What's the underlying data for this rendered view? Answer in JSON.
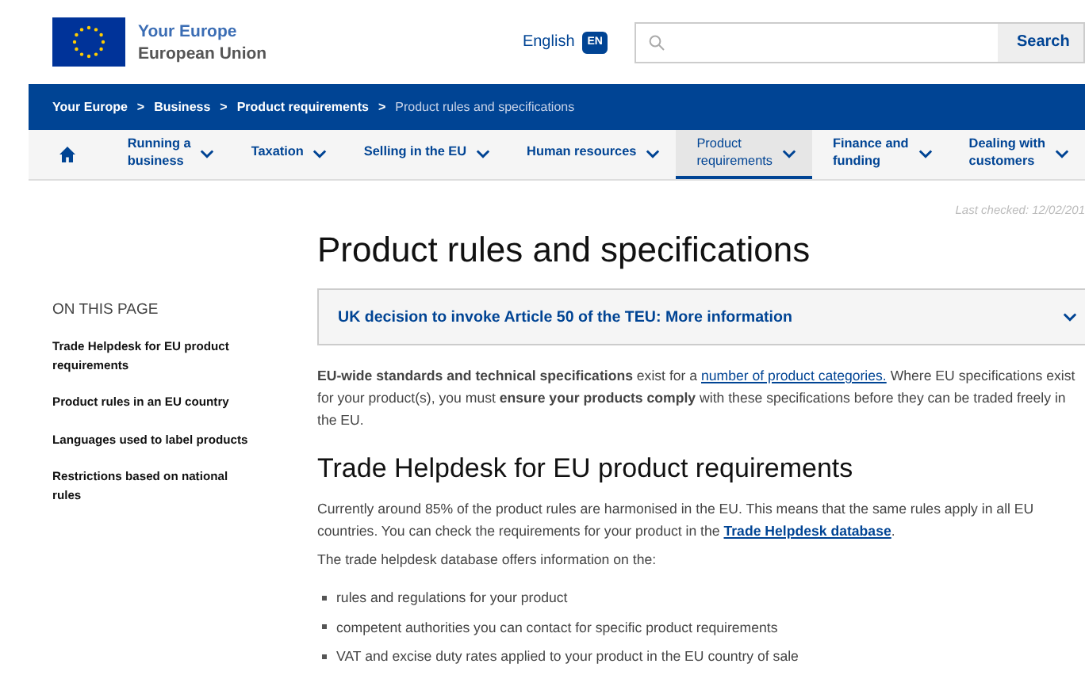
{
  "header": {
    "site_name": "Your Europe",
    "site_sub": "European Union",
    "language": "English",
    "language_badge": "EN",
    "search": {
      "button": "Search"
    }
  },
  "breadcrumb": [
    "Your Europe",
    "Business",
    "Product requirements",
    "Product rules and specifications"
  ],
  "breadcrumb_separator": ">",
  "nav": [
    {
      "lines": [
        "Running a",
        "business"
      ],
      "selected": false
    },
    {
      "lines": [
        "Taxation"
      ],
      "selected": false
    },
    {
      "lines": [
        "Selling in the EU"
      ],
      "selected": false
    },
    {
      "lines": [
        "Human resources"
      ],
      "selected": false
    },
    {
      "lines": [
        "Product",
        "requirements"
      ],
      "selected": true
    },
    {
      "lines": [
        "Finance and",
        "funding"
      ],
      "selected": false
    },
    {
      "lines": [
        "Dealing with",
        "customers"
      ],
      "selected": false
    }
  ],
  "last_checked": "Last checked: 12/02/201",
  "sidebar": {
    "heading": "ON THIS PAGE",
    "items": [
      "Trade Helpdesk for EU product requirements",
      "Product rules in an EU country",
      "Languages used to label products",
      "Restrictions based on national rules"
    ]
  },
  "title": "Product rules and specifications",
  "notice": {
    "text": "UK decision to invoke Article 50 of the TEU: More information",
    "expanded": false
  },
  "intro": {
    "before": "**EU-wide standards and technical specifications** exist for a ",
    "link": "number of product categories.",
    "after": " Where EU specifications exist for your product(s), you must **ensure your products comply** with these specifications before they can be traded freely in the EU."
  },
  "section": {
    "heading": "Trade Helpdesk for EU product requirements",
    "para": {
      "before": "Currently around 85% of the product rules are harmonised in the EU. This means that the same rules apply in all EU countries. You can check the requirements for your product in the ",
      "link": "Trade Helpdesk database",
      "after": "."
    },
    "lead": "The trade helpdesk database offers information on the:",
    "bullets": [
      "rules and regulations for your product",
      "competent authorities you can contact for specific product requirements",
      "VAT and excise duty rates applied to your product in the EU country of sale"
    ]
  }
}
